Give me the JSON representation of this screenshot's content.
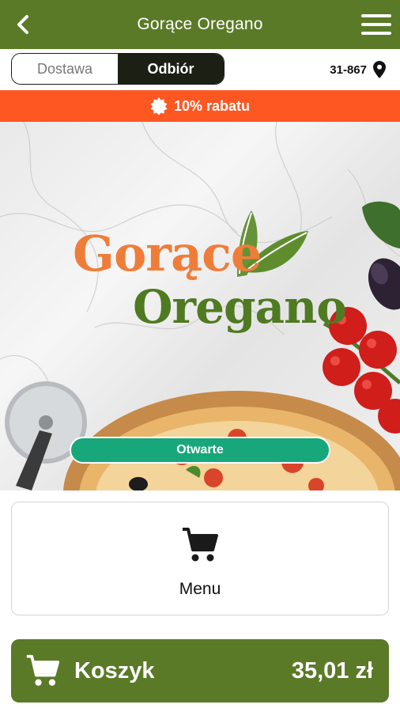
{
  "app_bar": {
    "title": "Gorące Oregano",
    "back_icon": "chevron-left-icon",
    "menu_icon": "hamburger-menu-icon"
  },
  "order_mode": {
    "options": [
      {
        "label": "Dostawa",
        "selected": false
      },
      {
        "label": "Odbiór",
        "selected": true
      }
    ],
    "postal_code": "31-867",
    "location_icon": "map-pin-icon"
  },
  "promo": {
    "icon": "badge-icon",
    "text": "10% rabatu"
  },
  "hero": {
    "logo_line1": "Gorące",
    "logo_line2": "Oregano",
    "status": "Otwarte"
  },
  "menu_card": {
    "icon": "cart-icon",
    "label": "Menu"
  },
  "cart_bar": {
    "icon": "cart-icon",
    "label": "Koszyk",
    "total": "35,01 zł"
  },
  "colors": {
    "brand_green": "#5a7a27",
    "promo_orange": "#ff5722",
    "status_green": "#18a77a",
    "logo_orange": "#ef7d3a",
    "logo_green": "#4f7a22"
  }
}
